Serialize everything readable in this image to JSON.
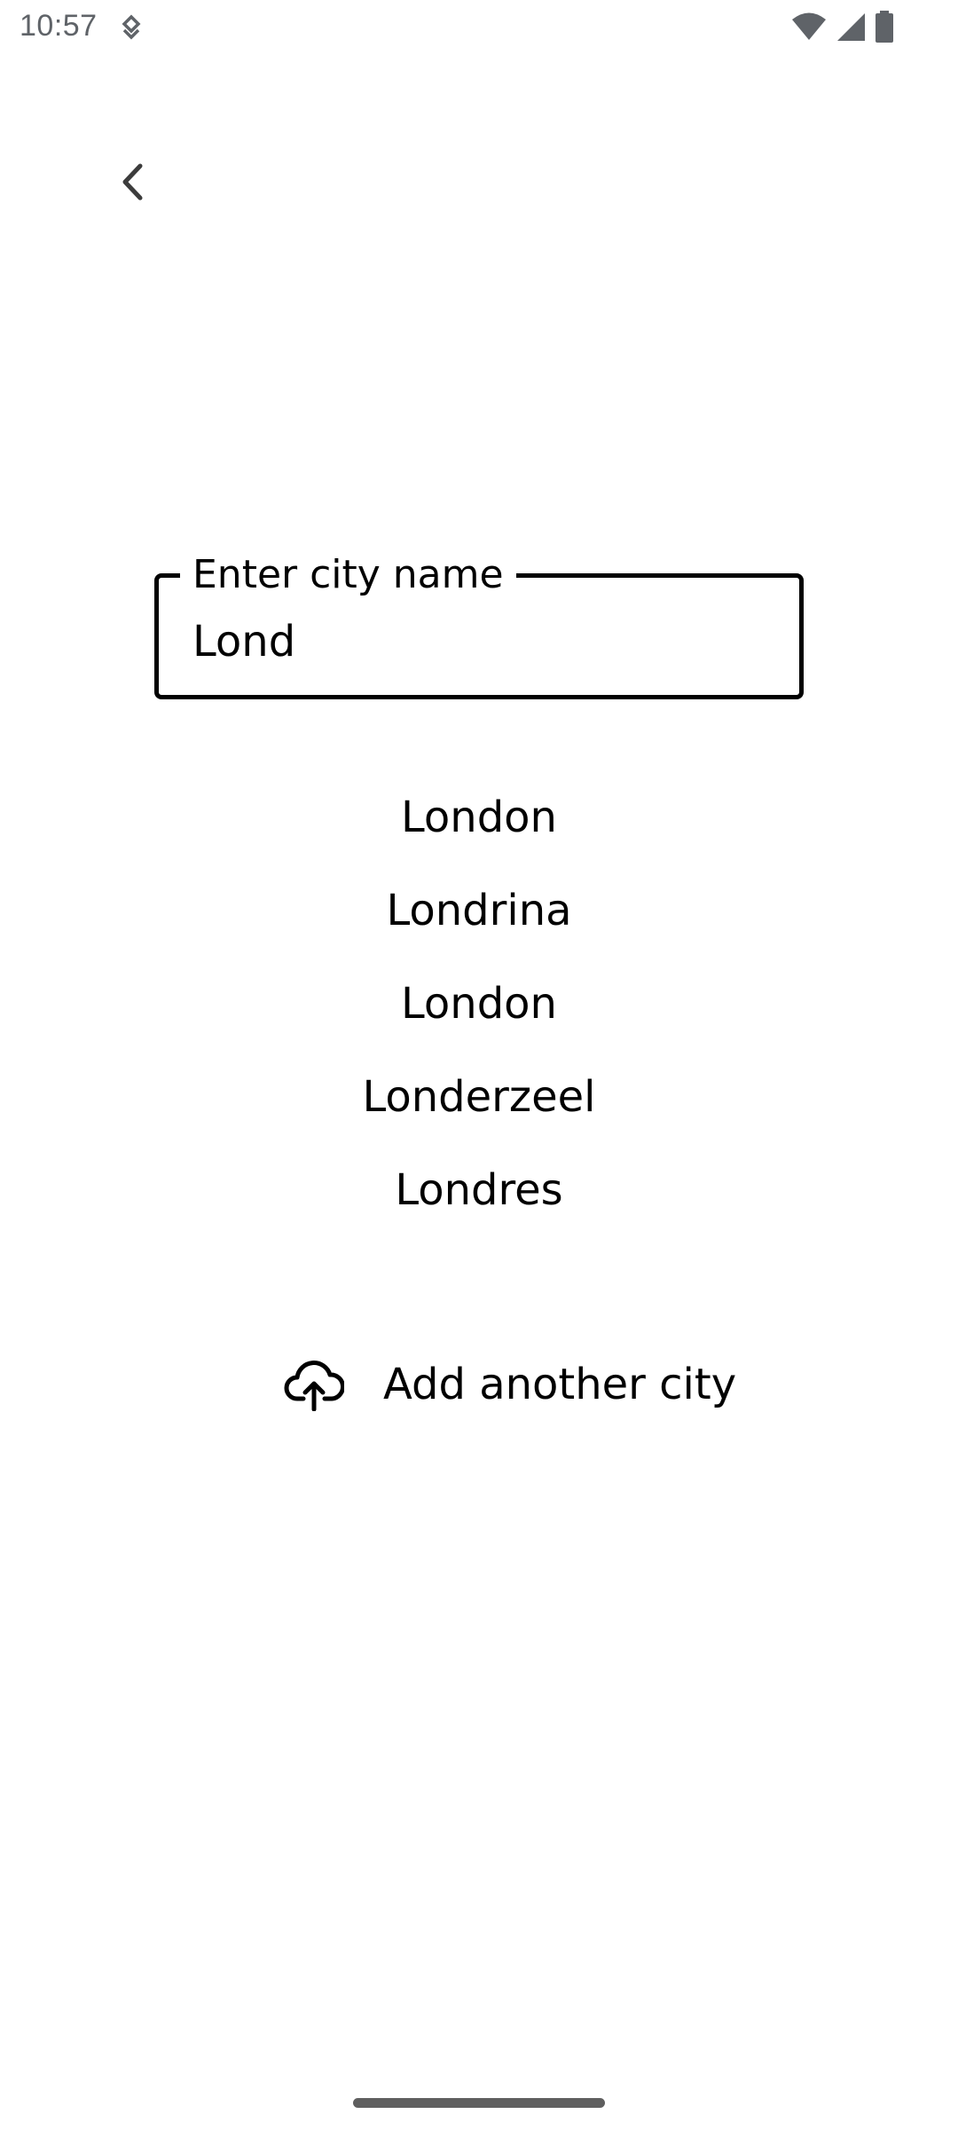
{
  "status_bar": {
    "time": "10:57",
    "icons": [
      "notification-icon",
      "wifi-icon",
      "cell-signal-icon",
      "battery-icon"
    ],
    "icon_color": "#5f6368"
  },
  "header": {
    "back_icon": "chevron-left-icon"
  },
  "city_input": {
    "label": "Enter city name",
    "value": "Lond"
  },
  "suggestions": [
    {
      "label": "London"
    },
    {
      "label": "Londrina"
    },
    {
      "label": "London"
    },
    {
      "label": "Londerzeel"
    },
    {
      "label": "Londres"
    }
  ],
  "add_city": {
    "icon": "cloud-upload-icon",
    "label": "Add another city"
  },
  "colors": {
    "background": "#ffffff",
    "text": "#000000",
    "gesture_bar": "#5f5f5f"
  }
}
